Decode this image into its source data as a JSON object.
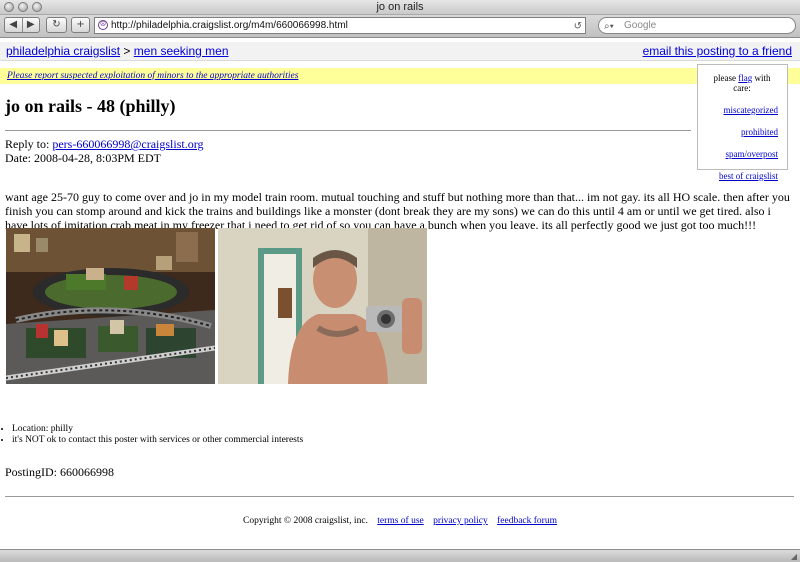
{
  "window": {
    "title": "jo on rails"
  },
  "toolbar": {
    "back_icon": "back-arrow-icon",
    "forward_icon": "forward-arrow-icon",
    "url": "http://philadelphia.craigslist.org/m4m/660066998.html",
    "search_placeholder": "Google"
  },
  "breadcrumb": {
    "site": "philadelphia craigslist",
    "separator": ">",
    "category": "men seeking men",
    "email_link": "email this posting to a friend"
  },
  "warning": "Please report suspected exploitation of minors to the appropriate authorities",
  "flag": {
    "intro": "please",
    "link": "flag",
    "suffix": "with care:",
    "options": [
      "miscategorized",
      "prohibited",
      "spam/overpost",
      "best of craigslist"
    ]
  },
  "posting": {
    "title": "jo on rails - 48 (philly)",
    "reply_label": "Reply to:",
    "reply_email": "pers-660066998@craigslist.org",
    "date": "Date: 2008-04-28, 8:03PM EDT",
    "body": "want age 25-70 guy to come over and jo in my model train room. mutual touching and stuff but nothing more than that... im not gay. its all HO scale. then after you finish you can stomp around and kick the trains and buildings like a monster (dont break they are my sons) we can do this until 4 am or until we get tired. also i have lots of imitation crab meat in my freezer that i need to get rid of so you can have a bunch when you leave. its all perfectly good we just got too much!!!",
    "location": "Location: philly",
    "notice": "it's NOT ok to contact this poster with services or other commercial interests",
    "posting_id": "PostingID: 660066998"
  },
  "footer": {
    "copyright": "Copyright © 2008 craigslist, inc.",
    "links": [
      "terms of use",
      "privacy policy",
      "feedback forum"
    ]
  }
}
